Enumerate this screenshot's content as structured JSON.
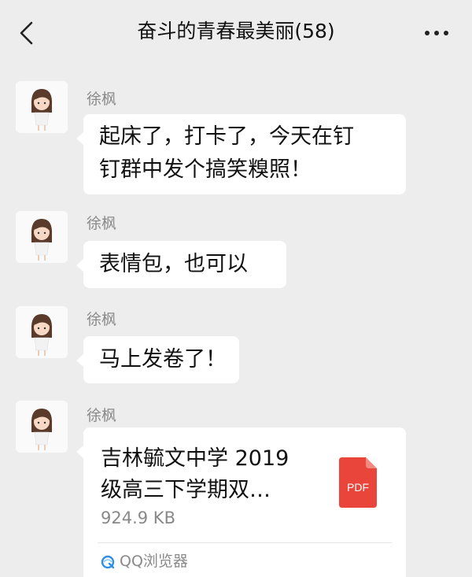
{
  "header": {
    "title": "奋斗的青春最美丽(58)",
    "back_icon": "chevron-left-icon",
    "more_icon": "more-dots-icon"
  },
  "messages": [
    {
      "sender": "徐枫",
      "lines": [
        "起床了，打卡了，今天在钉",
        "钉群中发个搞笑糗照！"
      ]
    },
    {
      "sender": "徐枫",
      "lines": [
        "表情包，也可以"
      ]
    },
    {
      "sender": "徐枫",
      "lines": [
        "马上发卷了！"
      ]
    },
    {
      "sender": "徐枫",
      "file": {
        "name_lines": [
          "吉林毓文中学 2019",
          "级高三下学期双…"
        ],
        "size": "924.9 KB",
        "type_label": "PDF",
        "source": "QQ浏览器"
      }
    }
  ],
  "colors": {
    "background": "#ededed",
    "bubble": "#ffffff",
    "pdf": "#e9453b"
  }
}
